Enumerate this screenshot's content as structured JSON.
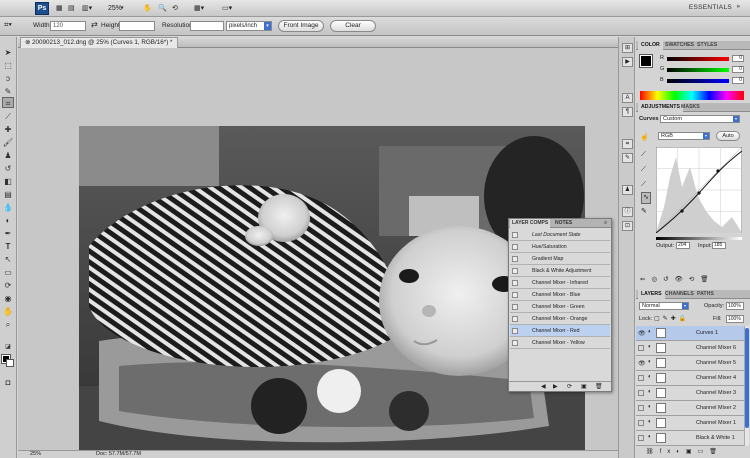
{
  "app": {
    "logo": "Ps",
    "zoom": "25%",
    "workspace": "ESSENTIALS"
  },
  "options": {
    "width_label": "Width:",
    "width_value": "120",
    "height_label": "Height:",
    "height_value": "",
    "resolution_label": "Resolution:",
    "resolution_value": "",
    "units": "pixels/inch",
    "front_image": "Front Image",
    "clear": "Clear"
  },
  "document": {
    "tab_title": "20090213_012.dng @ 25% (Curves 1, RGB/16*) *",
    "status_zoom": "25%",
    "status_doc": "Doc: 57.7M/57.7M"
  },
  "color_panel": {
    "tabs": [
      "COLOR",
      "SWATCHES",
      "STYLES"
    ],
    "channels": [
      {
        "label": "R",
        "value": "0"
      },
      {
        "label": "G",
        "value": "0"
      },
      {
        "label": "B",
        "value": "0"
      }
    ]
  },
  "adjustments": {
    "tabs": [
      "ADJUSTMENTS",
      "MASKS"
    ],
    "title": "Curves",
    "preset": "Custom",
    "channel": "RGB",
    "auto": "Auto",
    "output_label": "Output:",
    "output_value": "204",
    "input_label": "Input:",
    "input_value": "185"
  },
  "layers": {
    "tabs": [
      "LAYERS",
      "CHANNELS",
      "PATHS"
    ],
    "blend_mode": "Normal",
    "opacity_label": "Opacity:",
    "opacity_value": "100%",
    "lock_label": "Lock:",
    "fill_label": "Fill:",
    "fill_value": "100%",
    "items": [
      {
        "name": "Curves 1",
        "visible": true,
        "active": true
      },
      {
        "name": "Channel Mixer 6",
        "visible": false
      },
      {
        "name": "Channel Mixer 5",
        "visible": true
      },
      {
        "name": "Channel Mixer 4",
        "visible": false
      },
      {
        "name": "Channel Mixer 3",
        "visible": false
      },
      {
        "name": "Channel Mixer 2",
        "visible": false
      },
      {
        "name": "Channel Mixer 1",
        "visible": false
      },
      {
        "name": "Black & White 1",
        "visible": false
      }
    ]
  },
  "layer_comps": {
    "tabs": [
      "LAYER COMPS",
      "NOTES"
    ],
    "items": [
      {
        "name": "Last Document State"
      },
      {
        "name": "Hue/Saturation"
      },
      {
        "name": "Gradient Map"
      },
      {
        "name": "Black & White Adjustment"
      },
      {
        "name": "Channel Mixer - Infrared"
      },
      {
        "name": "Channel Mixer - Blue"
      },
      {
        "name": "Channel Mixer - Green"
      },
      {
        "name": "Channel Mixer - Orange"
      },
      {
        "name": "Channel Mixer - Red",
        "selected": true
      },
      {
        "name": "Channel Mixer - Yellow"
      }
    ]
  },
  "colors": {
    "accent_blue": "#3d6fcf",
    "selection": "#b5c9ea",
    "panel_bg": "#d4d4d4"
  }
}
